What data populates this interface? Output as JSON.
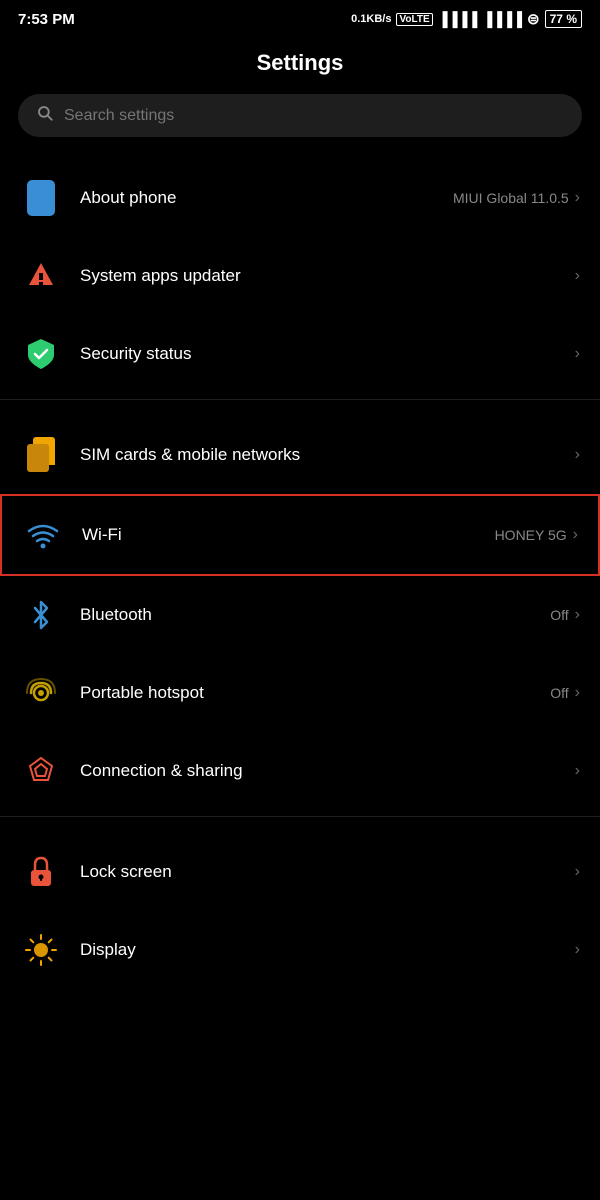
{
  "statusBar": {
    "time": "7:53 PM",
    "speed": "0.1KB/s",
    "network": "VoLTE",
    "battery": "77"
  },
  "header": {
    "title": "Settings"
  },
  "search": {
    "placeholder": "Search settings"
  },
  "groups": [
    {
      "items": [
        {
          "id": "about-phone",
          "label": "About phone",
          "subtitle": "MIUI Global 11.0.5",
          "icon": "phone-icon",
          "chevron": "›",
          "highlighted": false
        },
        {
          "id": "system-apps-updater",
          "label": "System apps updater",
          "subtitle": "",
          "icon": "update-icon",
          "chevron": "›",
          "highlighted": false
        },
        {
          "id": "security-status",
          "label": "Security status",
          "subtitle": "",
          "icon": "security-icon",
          "chevron": "›",
          "highlighted": false
        }
      ]
    },
    {
      "items": [
        {
          "id": "sim-cards",
          "label": "SIM cards & mobile networks",
          "subtitle": "",
          "icon": "sim-icon",
          "chevron": "›",
          "highlighted": false
        },
        {
          "id": "wifi",
          "label": "Wi-Fi",
          "subtitle": "HONEY 5G",
          "icon": "wifi-icon",
          "chevron": "›",
          "highlighted": true
        },
        {
          "id": "bluetooth",
          "label": "Bluetooth",
          "subtitle": "Off",
          "icon": "bluetooth-icon",
          "chevron": "›",
          "highlighted": false
        },
        {
          "id": "portable-hotspot",
          "label": "Portable hotspot",
          "subtitle": "Off",
          "icon": "hotspot-icon",
          "chevron": "›",
          "highlighted": false
        },
        {
          "id": "connection-sharing",
          "label": "Connection & sharing",
          "subtitle": "",
          "icon": "connection-icon",
          "chevron": "›",
          "highlighted": false
        }
      ]
    },
    {
      "items": [
        {
          "id": "lock-screen",
          "label": "Lock screen",
          "subtitle": "",
          "icon": "lock-icon",
          "chevron": "›",
          "highlighted": false
        },
        {
          "id": "display",
          "label": "Display",
          "subtitle": "",
          "icon": "display-icon",
          "chevron": "›",
          "highlighted": false
        }
      ]
    }
  ]
}
